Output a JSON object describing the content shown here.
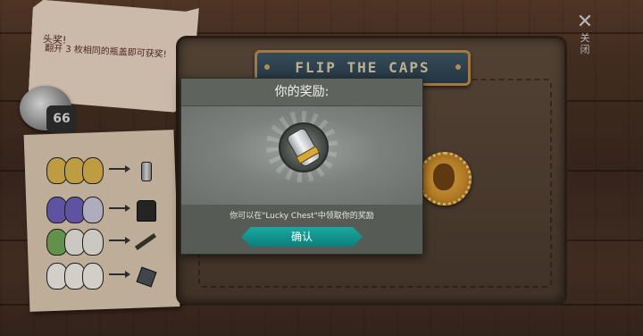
{
  "note": {
    "title": "头奖!",
    "text": "翻开 3 枚相同的瓶盖即可获奖!"
  },
  "ring_number": "66",
  "board": {
    "banner": "FLIP THE CAPS"
  },
  "close": {
    "icon": "close-icon",
    "label": "关闭"
  },
  "legend": {
    "rows": [
      {
        "face_color": "#d9b24a",
        "reward_icon": "canister-icon"
      },
      {
        "face_color": "#6b5fb8",
        "reward_icon": "jacket-icon"
      },
      {
        "face_color": "#6fa655",
        "reward_icon": "rifle-icon"
      },
      {
        "face_color": "#f0ece4",
        "reward_icon": "metal-plate-icon"
      }
    ]
  },
  "dialog": {
    "title": "你的奖励:",
    "reward_icon": "canister-icon",
    "message": "你可以在\"Lucky Chest\"中领取你的奖励",
    "confirm_label": "确认"
  },
  "colors": {
    "accent": "#12978f",
    "dialog_bg": "#575b55",
    "banner_bg": "#2f4452"
  }
}
